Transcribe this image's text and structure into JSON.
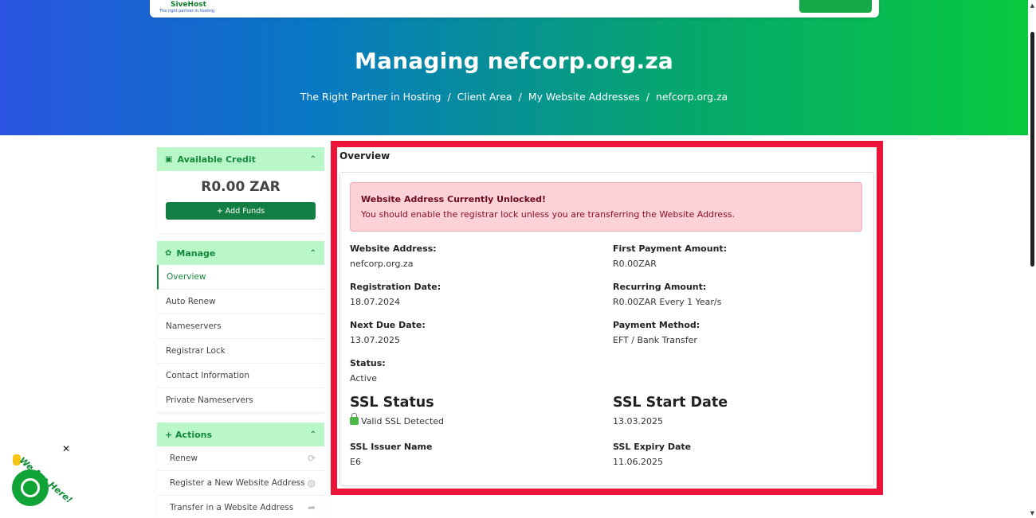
{
  "header": {
    "logo_name": "SiveHost",
    "logo_tagline": "The right partner in hosting",
    "title": "Managing nefcorp.org.za",
    "breadcrumb": [
      "The Right Partner in Hosting",
      "Client Area",
      "My Website Addresses",
      "nefcorp.org.za"
    ]
  },
  "sidebar": {
    "credit": {
      "title": "Available Credit",
      "amount": "R0.00 ZAR",
      "button": "+ Add Funds"
    },
    "manage": {
      "title": "Manage",
      "items": [
        {
          "label": "Overview"
        },
        {
          "label": "Auto Renew"
        },
        {
          "label": "Nameservers"
        },
        {
          "label": "Registrar Lock"
        },
        {
          "label": "Contact Information"
        },
        {
          "label": "Private Nameservers"
        }
      ]
    },
    "actions": {
      "title": "+ Actions",
      "items": [
        {
          "label": "Renew",
          "icon": "refresh-icon"
        },
        {
          "label": "Register a New Website Address",
          "icon": "globe-icon"
        },
        {
          "label": "Transfer in a Website Address",
          "icon": "share-arrow-icon"
        }
      ]
    }
  },
  "main": {
    "section_title": "Overview",
    "alert": {
      "title": "Website Address Currently Unlocked!",
      "text": "You should enable the registrar lock unless you are transferring the Website Address."
    },
    "fields": {
      "website_address": {
        "label": "Website Address:",
        "value": "nefcorp.org.za"
      },
      "first_payment": {
        "label": "First Payment Amount:",
        "value": "R0.00ZAR"
      },
      "registration_date": {
        "label": "Registration Date:",
        "value": "18.07.2024"
      },
      "recurring_amount": {
        "label": "Recurring Amount:",
        "value": "R0.00ZAR Every 1 Year/s"
      },
      "next_due_date": {
        "label": "Next Due Date:",
        "value": "13.07.2025"
      },
      "payment_method": {
        "label": "Payment Method:",
        "value": "EFT / Bank Transfer"
      },
      "status": {
        "label": "Status:",
        "value": "Active"
      }
    },
    "ssl": {
      "status_label": "SSL Status",
      "status_value": "Valid SSL Detected",
      "start_label": "SSL Start Date",
      "start_value": "13.03.2025",
      "issuer_label": "SSL Issuer Name",
      "issuer_value": "E6",
      "expiry_label": "SSL Expiry Date",
      "expiry_value": "11.06.2025"
    }
  },
  "chat": {
    "label": "We Are Here!",
    "close": "✕"
  },
  "colors": {
    "accent_green": "#14883a",
    "highlight_border": "#ec1339",
    "alert_bg": "#fcd2d8"
  }
}
